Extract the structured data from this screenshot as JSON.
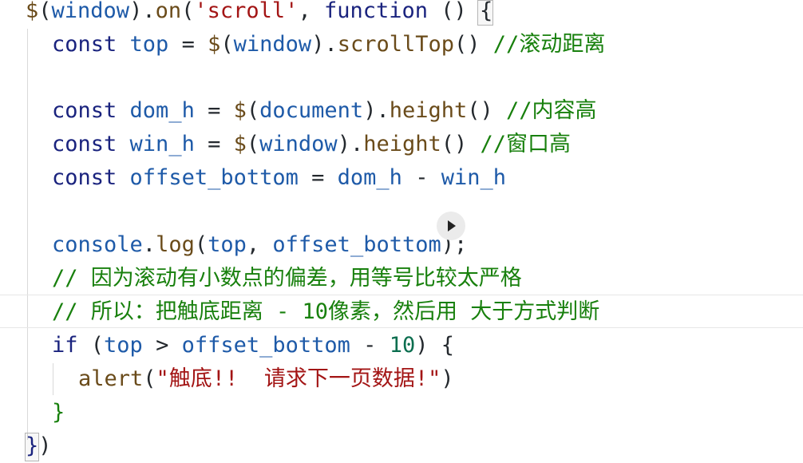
{
  "code": {
    "line1": {
      "dollar": "$",
      "paren_open": "(",
      "window": "window",
      "paren_close": ")",
      "dot": ".",
      "on": "on",
      "paren2": "(",
      "str": "'scroll'",
      "comma": ", ",
      "function": "function",
      "space_paren": " ()",
      "brace": " {"
    },
    "line2": {
      "const": "const",
      "top": "top",
      "eq": " = ",
      "dollar": "$",
      "po": "(",
      "window": "window",
      "pc": ")",
      "dot": ".",
      "fn": "scrollTop",
      "call": "()",
      "comment": " //滚动距离"
    },
    "line3": {
      "const": "const",
      "name": "dom_h",
      "eq": " = ",
      "dollar": "$",
      "po": "(",
      "obj": "document",
      "pc": ")",
      "dot": ".",
      "fn": "height",
      "call": "()",
      "comment": " //内容高"
    },
    "line4": {
      "const": "const",
      "name": "win_h",
      "eq": " = ",
      "dollar": "$",
      "po": "(",
      "obj": "window",
      "pc": ")",
      "dot": ".",
      "fn": "height",
      "call": "()",
      "comment": " //窗口高"
    },
    "line5": {
      "const": "const",
      "name": "offset_bottom",
      "eq": " = ",
      "a": "dom_h",
      "minus": " - ",
      "b": "win_h"
    },
    "line6": {
      "obj": "console",
      "dot": ".",
      "fn": "log",
      "po": "(",
      "a": "top",
      "comma": ", ",
      "b": "offset_bottom",
      "pc": ")",
      "semi": ";"
    },
    "line7": {
      "comment": "// 因为滚动有小数点的偏差，用等号比较太严格"
    },
    "line8": {
      "comment": "// 所以：把触底距离 - 10像素，然后用 大于方式判断"
    },
    "line9": {
      "if": "if",
      "po": " (",
      "a": "top",
      "gt": " > ",
      "b": "offset_bottom",
      "minus": " - ",
      "num": "10",
      "pc": ")",
      "brace": " {"
    },
    "line10": {
      "fn": "alert",
      "po": "(",
      "str": "\"触底!!  请求下一页数据!\"",
      "pc": ")"
    },
    "line11": {
      "brace": "}"
    },
    "line12": {
      "brace": "}",
      "pc": ")"
    }
  },
  "icons": {
    "play": "play-icon"
  }
}
